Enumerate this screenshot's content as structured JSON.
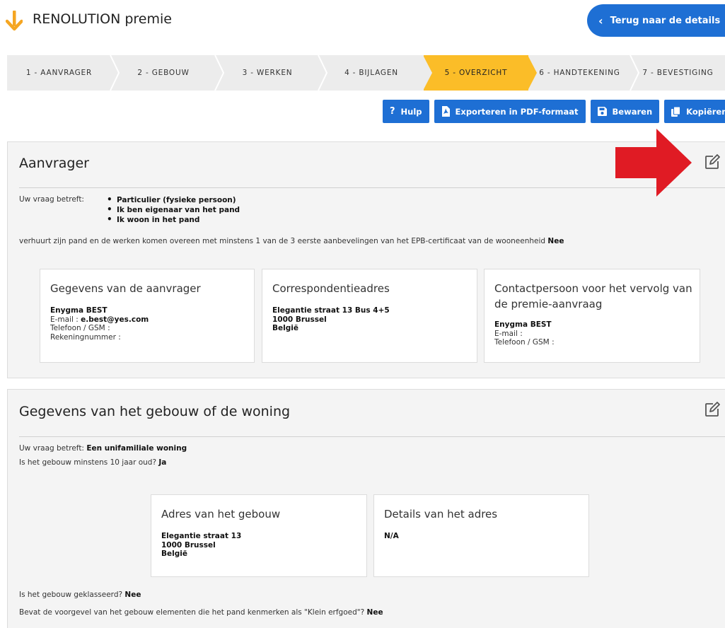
{
  "header": {
    "title": "RENOLUTION premie",
    "back_button": "Terug naar de details"
  },
  "steps": [
    "1 - AANVRAGER",
    "2 - GEBOUW",
    "3 - WERKEN",
    "4 - BIJLAGEN",
    "5 - OVERZICHT",
    "6 - HANDTEKENING",
    "7 - BEVESTIGING"
  ],
  "toolbar": {
    "help": "Hulp",
    "export": "Exporteren in PDF-formaat",
    "save": "Bewaren",
    "copy": "Kopiëren"
  },
  "aanvrager": {
    "title": "Aanvrager",
    "request_label": "Uw vraag betreft:",
    "bullets": [
      "Particulier (fysieke persoon)",
      "Ik ben eigenaar van het pand",
      "Ik woon in het pand"
    ],
    "rent_question": "verhuurt zijn pand en de werken komen overeen met minstens 1 van de 3 eerste aanbevelingen van het EPB-certificaat van de wooneenheid",
    "rent_answer": "Nee",
    "applicant_card": {
      "title": "Gegevens van de aanvrager",
      "name": "Enygma BEST",
      "email_label": "E-mail :",
      "email": "e.best@yes.com",
      "phone_label": "Telefoon / GSM :",
      "account_label": "Rekeningnummer :"
    },
    "correspondence_card": {
      "title": "Correspondentieadres",
      "street": "Elegantie straat 13 Bus 4+5",
      "city": "1000 Brussel",
      "country": "België"
    },
    "contact_card": {
      "title": "Contactpersoon voor het vervolg van de premie-aanvraag",
      "name": "Enygma BEST",
      "email_label": "E-mail :",
      "phone_label": "Telefoon / GSM :"
    }
  },
  "gebouw": {
    "title": "Gegevens van het gebouw of de woning",
    "request_label": "Uw vraag betreft:",
    "request_value": "Een unifamiliale woning",
    "age_question": "Is het gebouw minstens 10 jaar oud?",
    "age_answer": "Ja",
    "address_card": {
      "title": "Adres van het gebouw",
      "street": "Elegantie straat 13",
      "city": "1000 Brussel",
      "country": "België"
    },
    "details_card": {
      "title": "Details van het adres",
      "value": "N/A"
    },
    "classified_question": "Is het gebouw geklasseerd?",
    "classified_answer": "Nee",
    "heritage_question": "Bevat de voorgevel van het gebouw elementen die het pand kenmerken als \"Klein erfgoed\"?",
    "heritage_answer": "Nee"
  },
  "colors": {
    "primary_blue": "#1e6fd4",
    "active_step": "#fbbd28",
    "logo_orange": "#f5a623",
    "annotation_red": "#e01b24"
  }
}
